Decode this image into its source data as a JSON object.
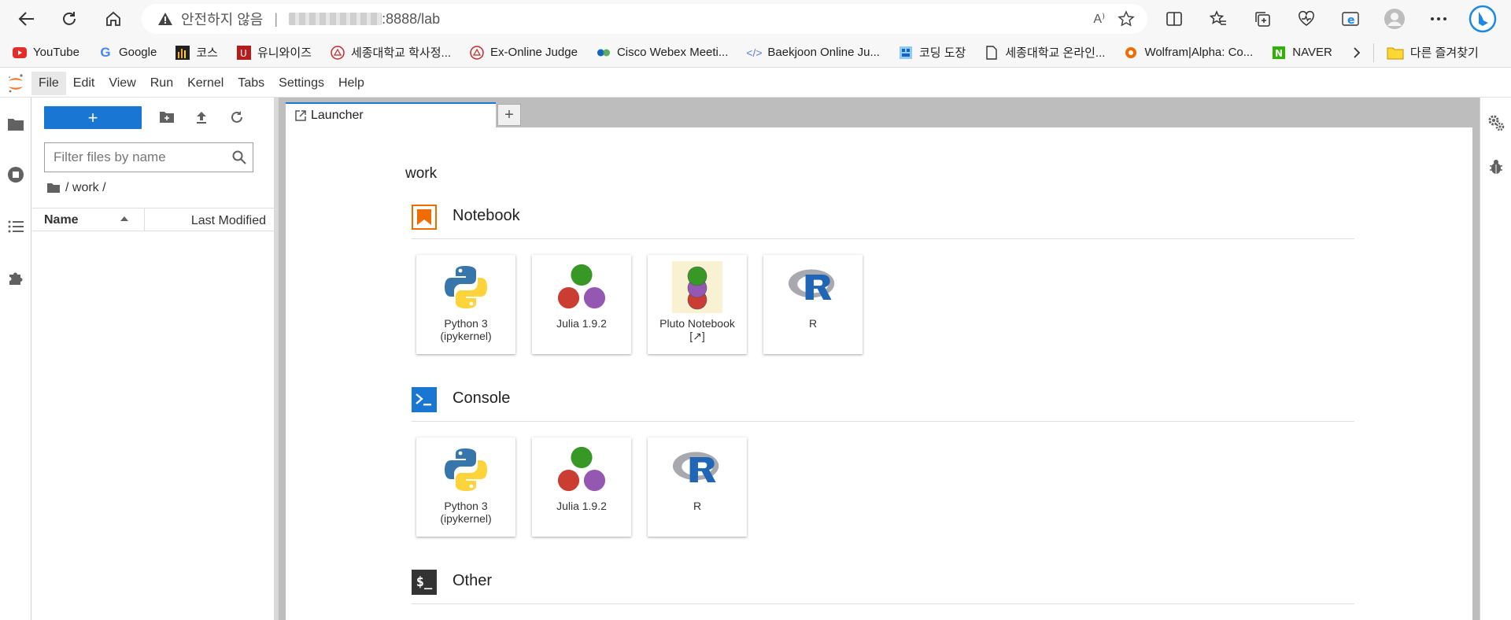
{
  "browser": {
    "security_label": "안전하지 않음",
    "url_path": ":8888/lab",
    "read_aloud_label": "A⁾"
  },
  "bookmarks": [
    {
      "label": "YouTube",
      "icon": "youtube-icon"
    },
    {
      "label": "Google",
      "icon": "google-icon"
    },
    {
      "label": "코스",
      "icon": "course-icon"
    },
    {
      "label": "유니와이즈",
      "icon": "uniwise-icon"
    },
    {
      "label": "세종대학교 학사정...",
      "icon": "sejong-icon"
    },
    {
      "label": "Ex-Online Judge",
      "icon": "judge-icon"
    },
    {
      "label": "Cisco Webex Meeti...",
      "icon": "webex-icon"
    },
    {
      "label": "Baekjoon Online Ju...",
      "icon": "code-icon"
    },
    {
      "label": "코딩 도장",
      "icon": "dojang-icon"
    },
    {
      "label": "세종대학교 온라인...",
      "icon": "page-icon"
    },
    {
      "label": "Wolfram|Alpha: Co...",
      "icon": "wolfram-icon"
    },
    {
      "label": "NAVER",
      "icon": "naver-icon"
    }
  ],
  "bookmarks_other": "다른 즐겨찾기",
  "menu": [
    "File",
    "Edit",
    "View",
    "Run",
    "Kernel",
    "Tabs",
    "Settings",
    "Help"
  ],
  "filebrowser": {
    "new_label": "+",
    "filter_placeholder": "Filter files by name",
    "breadcrumb": "/ work /",
    "col_name": "Name",
    "col_modified": "Last Modified"
  },
  "tabs": {
    "launcher_label": "Launcher",
    "add_label": "+"
  },
  "launcher": {
    "cwd": "work",
    "sections": {
      "notebook": {
        "title": "Notebook",
        "cards": {
          "python": "Python 3\n(ipykernel)",
          "julia": "Julia 1.9.2",
          "pluto": "Pluto Notebook\n[↗]",
          "r": "R"
        }
      },
      "console": {
        "title": "Console",
        "cards": {
          "python": "Python 3\n(ipykernel)",
          "julia": "Julia 1.9.2",
          "r": "R"
        }
      },
      "other": {
        "title": "Other",
        "icon_text": "$_"
      }
    }
  },
  "colors": {
    "jupyter_orange": "#f37726",
    "primary_blue": "#1976d2",
    "julia_green": "#389826",
    "julia_red": "#cb3c33",
    "julia_purple": "#9558b2"
  }
}
